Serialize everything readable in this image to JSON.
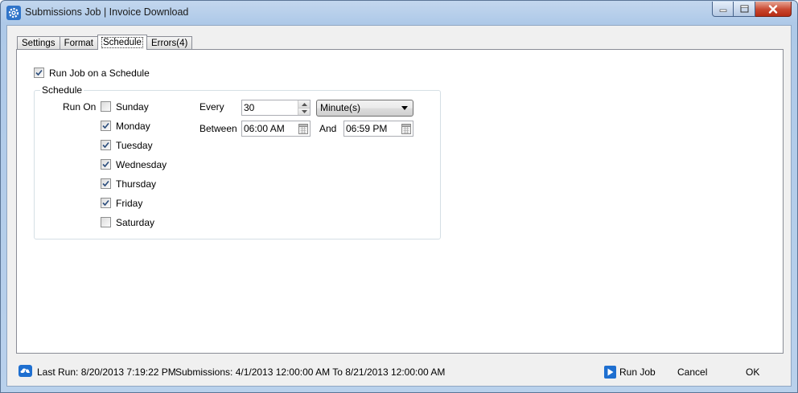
{
  "window": {
    "title": "Submissions Job | Invoice Download",
    "controls": {
      "minimize_icon": "minimize-icon",
      "maximize_icon": "maximize-icon",
      "close_icon": "close-icon"
    }
  },
  "tabs": [
    {
      "label": "Settings",
      "active": false
    },
    {
      "label": "Format",
      "active": false
    },
    {
      "label": "Schedule",
      "active": true
    },
    {
      "label": "Errors(4)",
      "active": false
    }
  ],
  "schedule": {
    "run_on_schedule": {
      "label": "Run Job on a Schedule",
      "checked": true
    },
    "group_title": "Schedule",
    "run_on_label": "Run On",
    "days": [
      {
        "label": "Sunday",
        "checked": false
      },
      {
        "label": "Monday",
        "checked": true
      },
      {
        "label": "Tuesday",
        "checked": true
      },
      {
        "label": "Wednesday",
        "checked": true
      },
      {
        "label": "Thursday",
        "checked": true
      },
      {
        "label": "Friday",
        "checked": true
      },
      {
        "label": "Saturday",
        "checked": false
      }
    ],
    "every_label": "Every",
    "every_value": "30",
    "interval_unit": "Minute(s)",
    "between_label": "Between",
    "start_time": "06:00 AM",
    "and_label": "And",
    "end_time": "06:59 PM"
  },
  "status": {
    "last_run": "Last Run: 8/20/2013 7:19:22 PM",
    "submissions": "Submissions: 4/1/2013 12:00:00 AM To 8/21/2013 12:00:00 AM"
  },
  "buttons": {
    "run_job": "Run Job",
    "cancel": "Cancel",
    "ok": "OK"
  },
  "colors": {
    "accent": "#1e6fd0",
    "title_bar": "#b9d1ec",
    "close_button": "#c8472f"
  }
}
